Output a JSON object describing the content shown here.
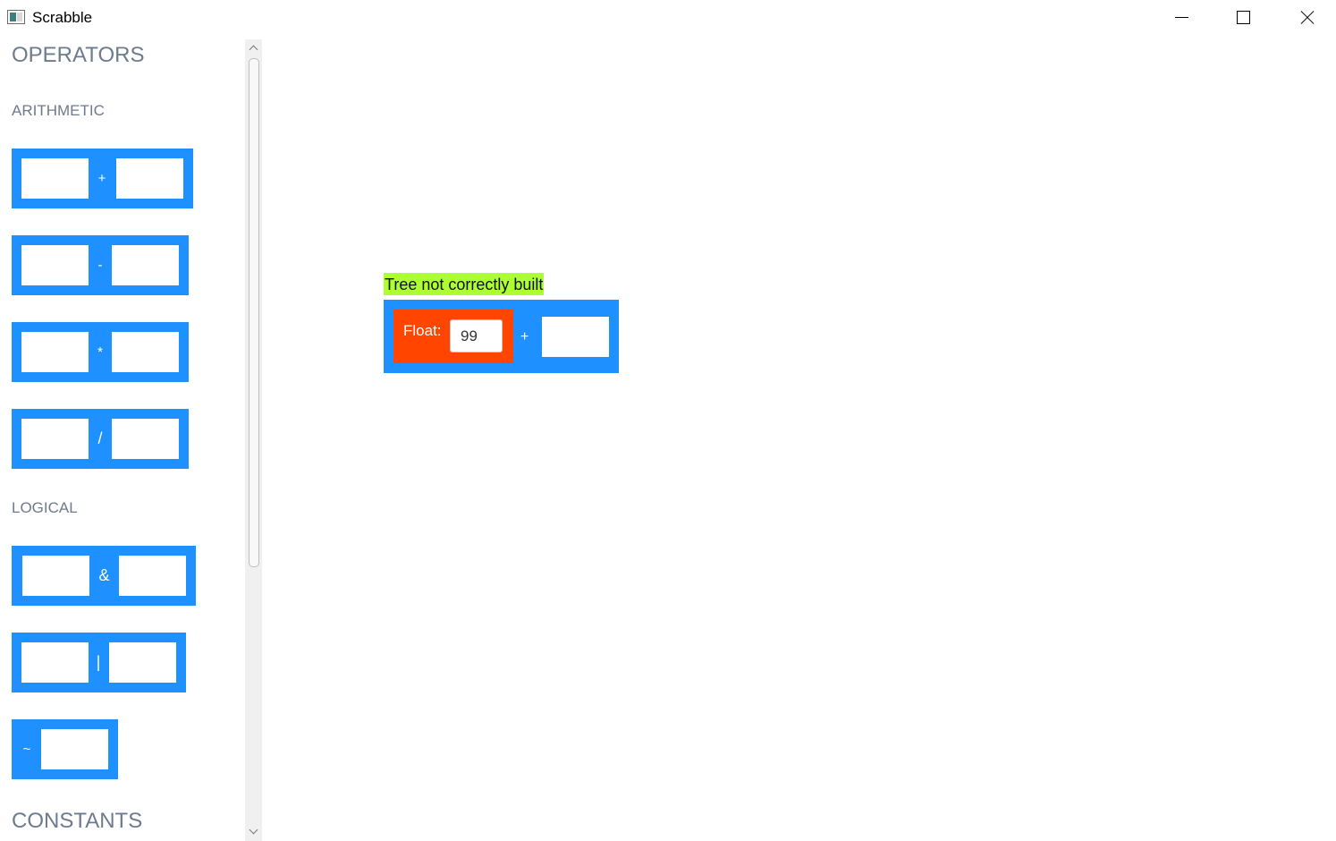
{
  "window": {
    "title": "Scrabble"
  },
  "sidebar": {
    "operators_title": "OPERATORS",
    "arithmetic_title": "ARITHMETIC",
    "arithmetic_ops": [
      "+",
      "-",
      "*",
      "/"
    ],
    "logical_title": "LOGICAL",
    "logical_ops": [
      "&",
      "|",
      "~"
    ],
    "constants_title": "CONSTANTS"
  },
  "canvas": {
    "status": "Tree not correctly built",
    "float_label": "Float:",
    "float_value": "99",
    "operator": "+"
  },
  "colors": {
    "block": "#1e90ff",
    "float_node": "#ff4500",
    "status_bg": "#adff2f",
    "heading": "#6d7b8d"
  }
}
